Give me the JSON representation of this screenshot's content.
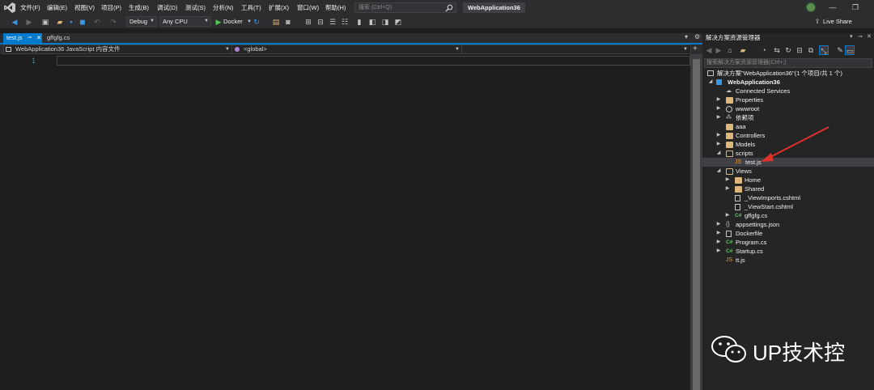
{
  "menu": {
    "items": [
      "文件(F)",
      "编辑(E)",
      "视图(V)",
      "项目(P)",
      "生成(B)",
      "调试(D)",
      "测试(S)",
      "分析(N)",
      "工具(T)",
      "扩展(X)",
      "窗口(W)",
      "帮助(H)"
    ],
    "search_placeholder": "搜索 (Ctrl+Q)",
    "window_title": "WebApplication36"
  },
  "toolbar": {
    "configuration": "Debug",
    "platform": "Any CPU",
    "run_target": "Docker",
    "live_share": "Live Share"
  },
  "editor": {
    "tabs": [
      {
        "label": "test.js",
        "active": true
      },
      {
        "label": "gffgfg.cs",
        "active": false
      }
    ],
    "nav_project": "WebApplication36 JavaScript 内容文件",
    "nav_scope": "<global>",
    "line_number": "1"
  },
  "solution_explorer": {
    "title": "解决方案资源管理器",
    "search_placeholder": "搜索解决方案资源管理器(Ctrl+;)",
    "solution_label": "解决方案\"WebApplication36\"(1 个项目/共 1 个)",
    "project": "WebApplication36",
    "items": {
      "connected_services": "Connected Services",
      "properties": "Properties",
      "wwwroot": "wwwroot",
      "dependencies": "依赖项",
      "aaa": "aaa",
      "controllers": "Controllers",
      "models": "Models",
      "scripts": "scripts",
      "test_js": "test.js",
      "views": "Views",
      "home": "Home",
      "shared": "Shared",
      "viewimports": "_ViewImports.cshtml",
      "viewstart": "_ViewStart.cshtml",
      "gffgfg": "gffgfg.cs",
      "appsettings": "appsettings.json",
      "dockerfile": "Dockerfile",
      "program": "Program.cs",
      "startup": "Startup.cs",
      "ttjs": "tt.js"
    }
  },
  "colors": {
    "accent": "#007acc",
    "arrow": "#e0302a"
  },
  "watermark": {
    "text": "UP技术控"
  }
}
